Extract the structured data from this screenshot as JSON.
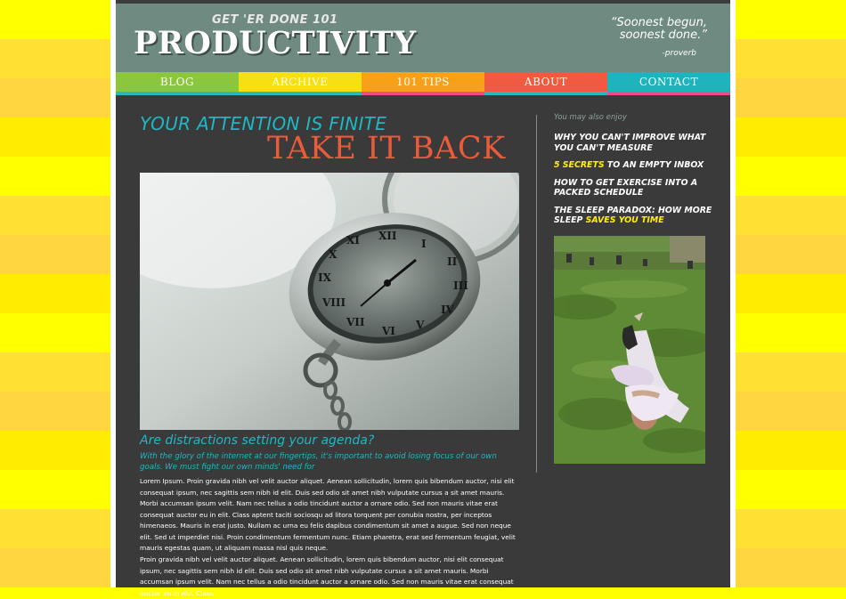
{
  "header": {
    "tagline": "GET 'ER DONE 101",
    "title": "PRODUCTIVITY",
    "quote_line1": "“Soonest begun,",
    "quote_line2": "soonest done.”",
    "quote_attrib": "-proverb"
  },
  "nav": [
    {
      "label": "BLOG",
      "color": "#8cc63f",
      "border": "#2fb5c2"
    },
    {
      "label": "ARCHIVE",
      "color": "#f6e013",
      "border": "#2fb5c2"
    },
    {
      "label": "101 TIPS",
      "color": "#f7a11a",
      "border": "#eb4c8a"
    },
    {
      "label": "ABOUT",
      "color": "#ef5a40",
      "border": "#2fb5c2"
    },
    {
      "label": "CONTACT",
      "color": "#1fb3bd",
      "border": "#eb4c8a"
    }
  ],
  "article": {
    "heading1": "YOUR ATTENTION IS FINITE",
    "heading2": "TAKE IT BACK",
    "subheading": "Are distractions setting your agenda?",
    "lede": "With the glory of the internet at our fingertips, it's important to avoid losing focus of our own goals. We must fight our own minds' need for",
    "body1": "Lorem Ipsum. Proin gravida nibh vel velit auctor aliquet. Aenean sollicitudin, lorem quis bibendum auctor, nisi elit consequat ipsum, nec sagittis sem nibh id elit. Duis sed odio sit amet nibh vulputate cursus a sit amet mauris. Morbi accumsan ipsum velit. Nam nec tellus a odio tincidunt auctor a ornare odio. Sed non mauris vitae erat consequat auctor eu in elit. Class aptent taciti sociosqu ad litora torquent per conubia nostra, per inceptos himenaeos. Mauris in erat justo. Nullam ac urna eu felis dapibus condimentum sit amet a augue. Sed non neque elit. Sed ut imperdiet nisi. Proin condimentum fermentum nunc. Etiam pharetra, erat sed fermentum feugiat, velit mauris egestas quam, ut aliquam massa nisl quis neque.",
    "body2": "Proin gravida nibh vel velit auctor aliquet. Aenean sollicitudin, lorem quis bibendum auctor, nisi elit consequat ipsum, nec sagittis sem nibh id elit. Duis sed odio sit amet nibh vulputate cursus a sit amet mauris. Morbi accumsan ipsum velit. Nam nec tellus a odio tincidunt auctor a ornare odio. Sed non mauris vitae erat consequat auctor eu in elit. Class"
  },
  "sidebar": {
    "also_label": "You may also enjoy",
    "links": [
      {
        "pre": "WHY YOU CAN'T IMPROVE WHAT YOU CAN'T MEASURE",
        "hl": "",
        "post": ""
      },
      {
        "pre": "",
        "hl": "5 SECRETS",
        "post": " TO AN EMPTY INBOX"
      },
      {
        "pre": "HOW TO GET EXERCISE INTO A PACKED SCHEDULE",
        "hl": "",
        "post": ""
      },
      {
        "pre": "THE SLEEP PARADOX: HOW MORE SLEEP ",
        "hl": "SAVES YOU TIME",
        "post": ""
      }
    ]
  },
  "colors": {
    "accent_teal": "#1fb8c4",
    "accent_orange": "#ea5b3a",
    "highlight_yellow": "#fff200",
    "header_bg": "#6e8a81",
    "main_bg": "#3a3a3a"
  }
}
